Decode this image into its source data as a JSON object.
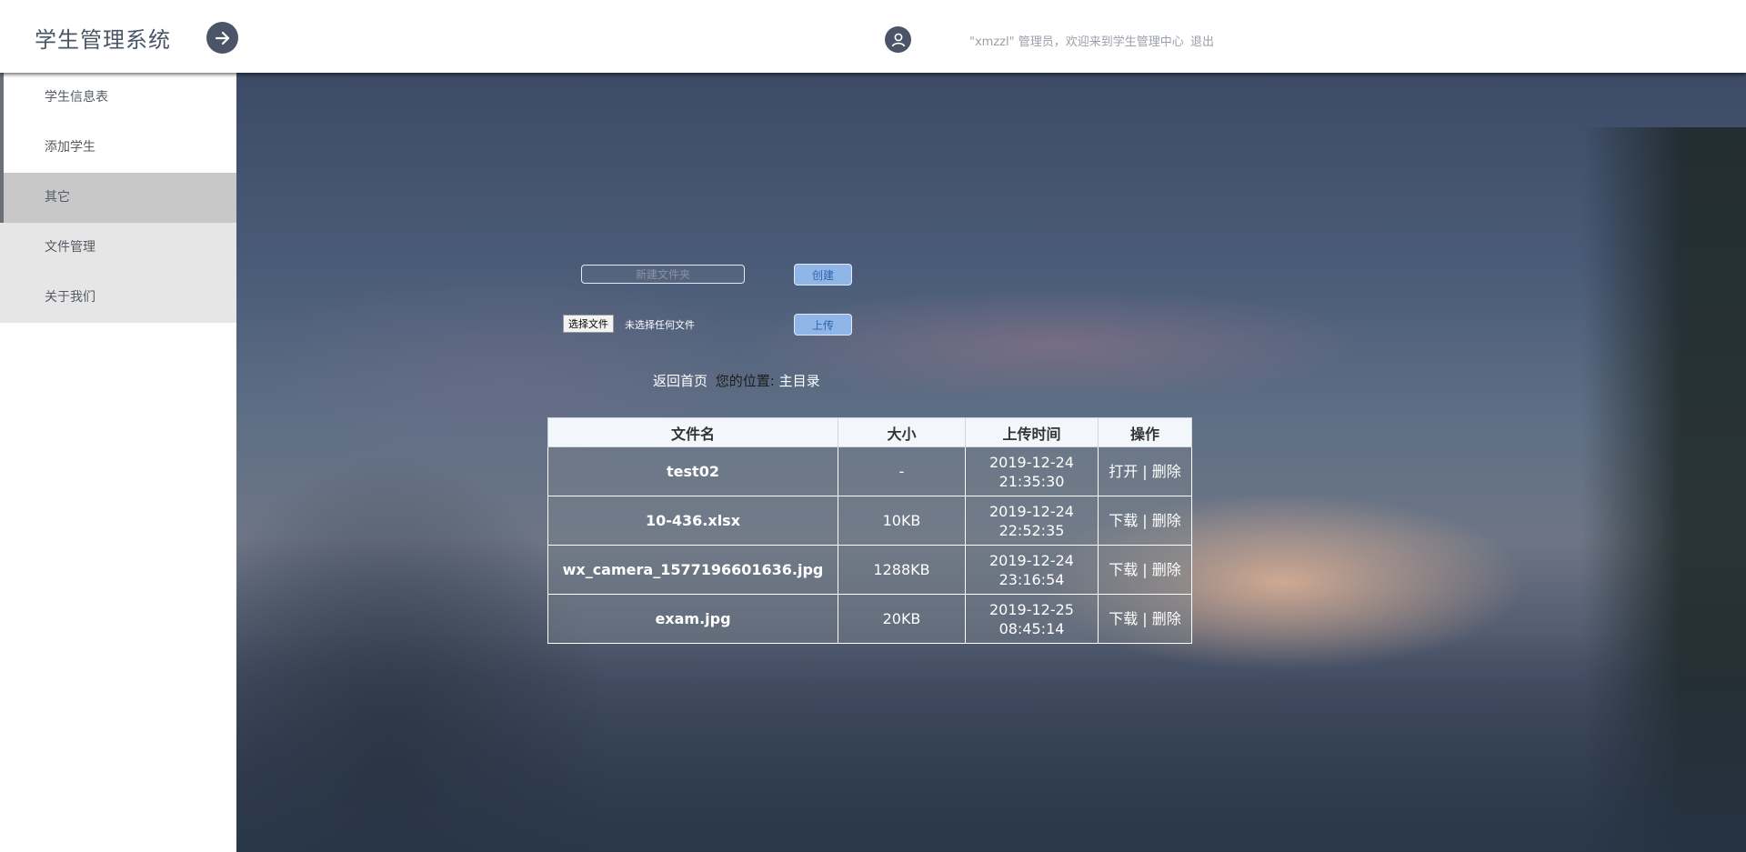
{
  "header": {
    "brand": "学生管理系统",
    "welcome": "\"xmzzl\" 管理员，欢迎来到学生管理中心",
    "logout": "退出"
  },
  "sidebar": {
    "items": [
      {
        "label": "学生信息表"
      },
      {
        "label": "添加学生"
      },
      {
        "label": "其它"
      },
      {
        "label": "文件管理"
      },
      {
        "label": "关于我们"
      }
    ]
  },
  "toolbar": {
    "folder_placeholder": "新建文件夹",
    "create_label": "创建",
    "choose_file_label": "选择文件",
    "no_file_text": "未选择任何文件",
    "upload_label": "上传"
  },
  "breadcrumb": {
    "home": "返回首页",
    "location_label": "您的位置:",
    "location_value": "主目录"
  },
  "table": {
    "headers": [
      "文件名",
      "大小",
      "上传时间",
      "操作"
    ],
    "rows": [
      {
        "name": "test02",
        "size": "-",
        "date": "2019-12-24",
        "time": "21:35:30",
        "op1": "打开",
        "sep": "|",
        "op2": "删除"
      },
      {
        "name": "10-436.xlsx",
        "size": "10KB",
        "date": "2019-12-24",
        "time": "22:52:35",
        "op1": "下载",
        "sep": "|",
        "op2": "删除"
      },
      {
        "name": "wx_camera_1577196601636.jpg",
        "size": "1288KB",
        "date": "2019-12-24",
        "time": "23:16:54",
        "op1": "下载",
        "sep": "|",
        "op2": "删除"
      },
      {
        "name": "exam.jpg",
        "size": "20KB",
        "date": "2019-12-25",
        "time": "08:45:14",
        "op1": "下载",
        "sep": "|",
        "op2": "删除"
      }
    ]
  },
  "icons": {
    "toggle": "arrow-right-icon",
    "avatar": "user-icon"
  },
  "colors": {
    "header_accent": "#4b5567",
    "button_blue": "#8fb6e6",
    "active_menu": "#c8c8c8"
  }
}
